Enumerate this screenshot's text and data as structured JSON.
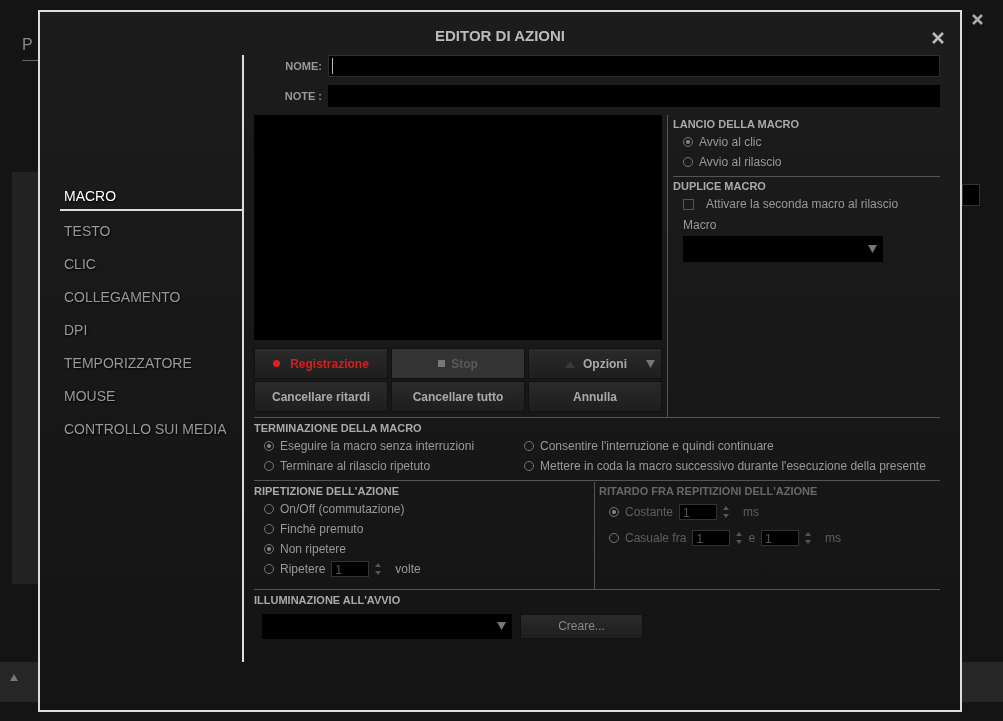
{
  "background_app": {
    "tab": "P"
  },
  "dialog": {
    "title": "EDITOR DI AZIONI"
  },
  "nav": [
    {
      "label": "MACRO",
      "selected": true
    },
    {
      "label": "TESTO",
      "selected": false
    },
    {
      "label": "CLIC",
      "selected": false
    },
    {
      "label": "COLLEGAMENTO",
      "selected": false
    },
    {
      "label": "DPI",
      "selected": false
    },
    {
      "label": "TEMPORIZZATORE",
      "selected": false
    },
    {
      "label": "MOUSE",
      "selected": false
    },
    {
      "label": "CONTROLLO SUI MEDIA",
      "selected": false
    }
  ],
  "fields": [
    {
      "label": "NOME:",
      "focused": true
    },
    {
      "label": "NOTE :",
      "focused": false
    }
  ],
  "record_buttons": [
    {
      "kind": "record",
      "label": "Registrazione",
      "disabled": false
    },
    {
      "kind": "stop",
      "label": "Stop",
      "disabled": true
    },
    {
      "kind": "options",
      "label": "Opzioni",
      "disabled": false
    }
  ],
  "edit_buttons": [
    "Cancellare ritardi",
    "Cancellare tutto",
    "Annulla"
  ],
  "launch": {
    "title": "LANCIO DELLA MACRO",
    "options": [
      {
        "label": "Avvio al clic",
        "selected": true
      },
      {
        "label": "Avvio al rilascio",
        "selected": false
      }
    ]
  },
  "duplicate": {
    "title": "DUPLICE MACRO",
    "checkbox": {
      "label": "Attivare la seconda macro al rilascio",
      "checked": false
    },
    "select_label": "Macro"
  },
  "termination": {
    "title": "TERMINAZIONE DELLA MACRO",
    "options": [
      {
        "label": "Eseguire la macro senza interruzioni",
        "selected": true
      },
      {
        "label": "Consentire l'interruzione e quindi continuare",
        "selected": false
      },
      {
        "label": "Terminare al rilascio ripetuto",
        "selected": false
      },
      {
        "label": "Mettere in coda la macro successivo durante l'esecuzione della presente",
        "selected": false
      }
    ]
  },
  "repetition": {
    "title": "RIPETIZIONE DELL'AZIONE",
    "options": [
      {
        "label": "On/Off (commutazione)",
        "selected": false
      },
      {
        "label": "Finchè premuto",
        "selected": false
      },
      {
        "label": "Non ripetere",
        "selected": true
      },
      {
        "label": "Ripetere",
        "selected": false,
        "count": "1",
        "unit": "volte"
      }
    ]
  },
  "delay": {
    "title": "RITARDO FRA REPITIZIONI DELL'AZIONE",
    "disabled": true,
    "options": [
      {
        "label": "Costante",
        "selected": true,
        "value": "1",
        "unit": "ms"
      },
      {
        "label": "Casuale fra",
        "selected": false,
        "from": "1",
        "and": "e",
        "to": "1",
        "unit": "ms"
      }
    ]
  },
  "lighting": {
    "title": "ILLUMINAZIONE ALL'AVVIO",
    "button": "Creare..."
  }
}
